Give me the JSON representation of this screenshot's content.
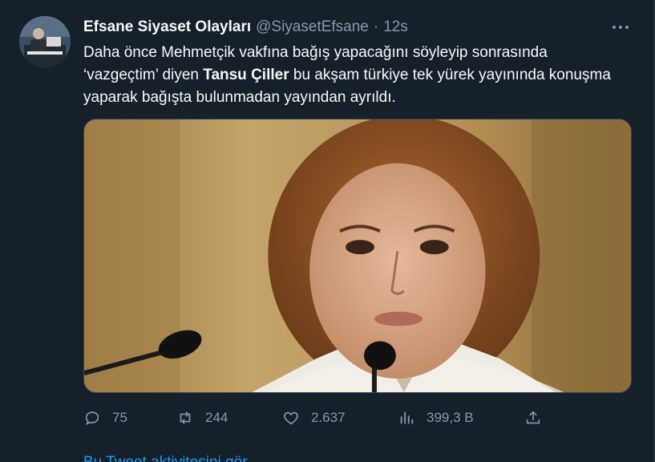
{
  "tweet": {
    "author_name": "Efsane Siyaset Olayları",
    "handle": "@SiyasetEfsane",
    "separator": "·",
    "time": "12s",
    "text_part1": "Daha önce Mehmetçik vakfına bağış yapacağını söyleyip sonrasında ‘vazgeçtim’ diyen ",
    "text_bold": "Tansu Çiller",
    "text_part2": " bu akşam türkiye tek yürek yayınında konuşma yaparak bağışta bulunmadan yayından ayrıldı."
  },
  "actions": {
    "reply_count": "75",
    "retweet_count": "244",
    "like_count": "2.637",
    "views_count": "399,3 B"
  },
  "icons": {
    "reply": "reply-icon",
    "retweet": "retweet-icon",
    "like": "heart-icon",
    "views": "views-icon",
    "share": "share-icon",
    "more": "more-icon"
  },
  "colors": {
    "background": "#15202b",
    "text": "#f7f9f9",
    "muted": "#8b98a5",
    "link": "#1d9bf0"
  },
  "bottom_link": "Bu Tweet aktivitesini gör"
}
